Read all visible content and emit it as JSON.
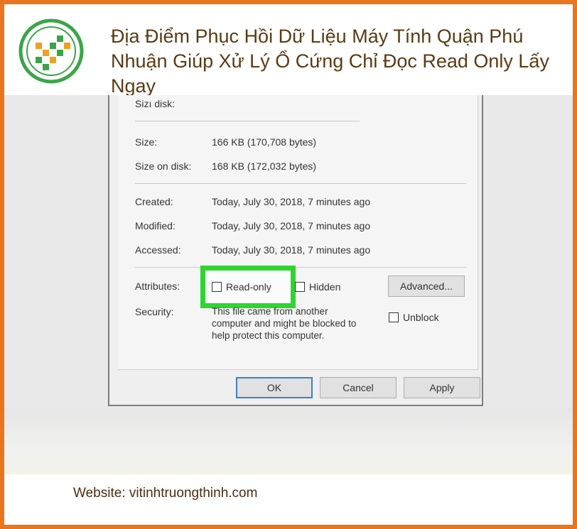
{
  "title": "Địa Điểm Phục Hồi Dữ Liệu Máy Tính Quận Phú Nhuận Giúp Xử Lý Ổ Cứng Chỉ Đọc Read Only Lấy Ngay",
  "logo_icon": "pixel-arrow-logo-icon",
  "colors": {
    "frame": "#e8761e",
    "logo_green": "#3aa548",
    "logo_orange": "#f0a020",
    "highlight": "#2fd52f"
  },
  "dialog": {
    "size_disk_label": "Sizı disk:",
    "size_label": "Size:",
    "size_value": "166 KB (170,708 bytes)",
    "size_on_disk_label": "Size on disk:",
    "size_on_disk_value": "168 KB (172,032 bytes)",
    "created_label": "Created:",
    "created_value": "Today, July 30, 2018, 7 minutes ago",
    "modified_label": "Modified:",
    "modified_value": "Today, July 30, 2018, 7 minutes ago",
    "accessed_label": "Accessed:",
    "accessed_value": "Today, July 30, 2018, 7 minutes ago",
    "attributes_label": "Attributes:",
    "readonly_label": "Read-only",
    "hidden_label": "Hidden",
    "advanced_button": "Advanced...",
    "security_label": "Security:",
    "security_text_line1": "This file came from another",
    "security_text_line2": "computer and might be blocked to",
    "security_text_line3": "help protect this computer.",
    "unblock_label": "Unblock",
    "ok_button": "OK",
    "cancel_button": "Cancel",
    "apply_button": "Apply"
  },
  "footer": {
    "website": "Website: vitinhtruongthinh.com"
  }
}
